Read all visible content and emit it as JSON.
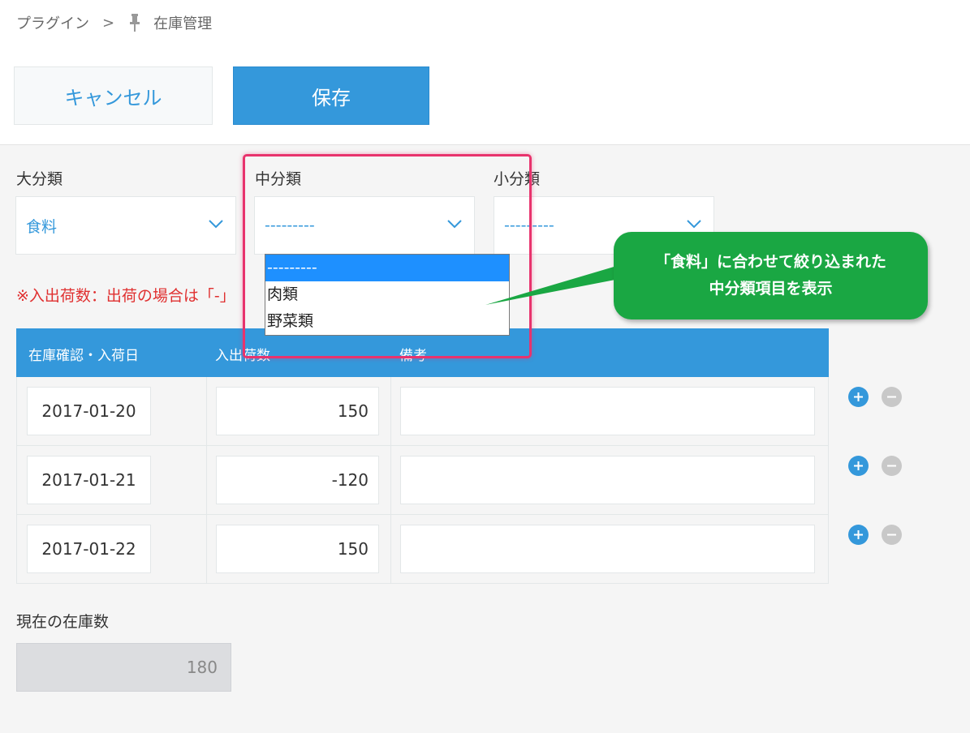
{
  "breadcrumb": {
    "root": "プラグイン",
    "separator": ">",
    "current": "在庫管理",
    "icon": "pin-icon"
  },
  "toolbar": {
    "cancel_label": "キャンセル",
    "save_label": "保存"
  },
  "filters": {
    "major": {
      "label": "大分類",
      "value": "食料"
    },
    "middle": {
      "label": "中分類",
      "value": "---------"
    },
    "minor": {
      "label": "小分類",
      "value": "---------"
    }
  },
  "dropdown": {
    "options": [
      "---------",
      "肉類",
      "野菜類"
    ],
    "selected_index": 0
  },
  "note": "※入出荷数：出荷の場合は「-」",
  "table": {
    "headers": [
      "在庫確認・入荷日",
      "入出荷数",
      "備考"
    ],
    "rows": [
      {
        "date": "2017-01-20",
        "qty": "150",
        "remark": ""
      },
      {
        "date": "2017-01-21",
        "qty": "-120",
        "remark": ""
      },
      {
        "date": "2017-01-22",
        "qty": "150",
        "remark": ""
      }
    ]
  },
  "stock": {
    "label": "現在の在庫数",
    "value": "180"
  },
  "callout": {
    "line1": "「食料」に合わせて絞り込まれた",
    "line2": "中分類項目を表示"
  },
  "colors": {
    "accent": "#3498db",
    "note": "#e03030",
    "highlight": "#e8336d",
    "callout": "#1aa743",
    "dropdown_selected": "#1e90ff"
  }
}
